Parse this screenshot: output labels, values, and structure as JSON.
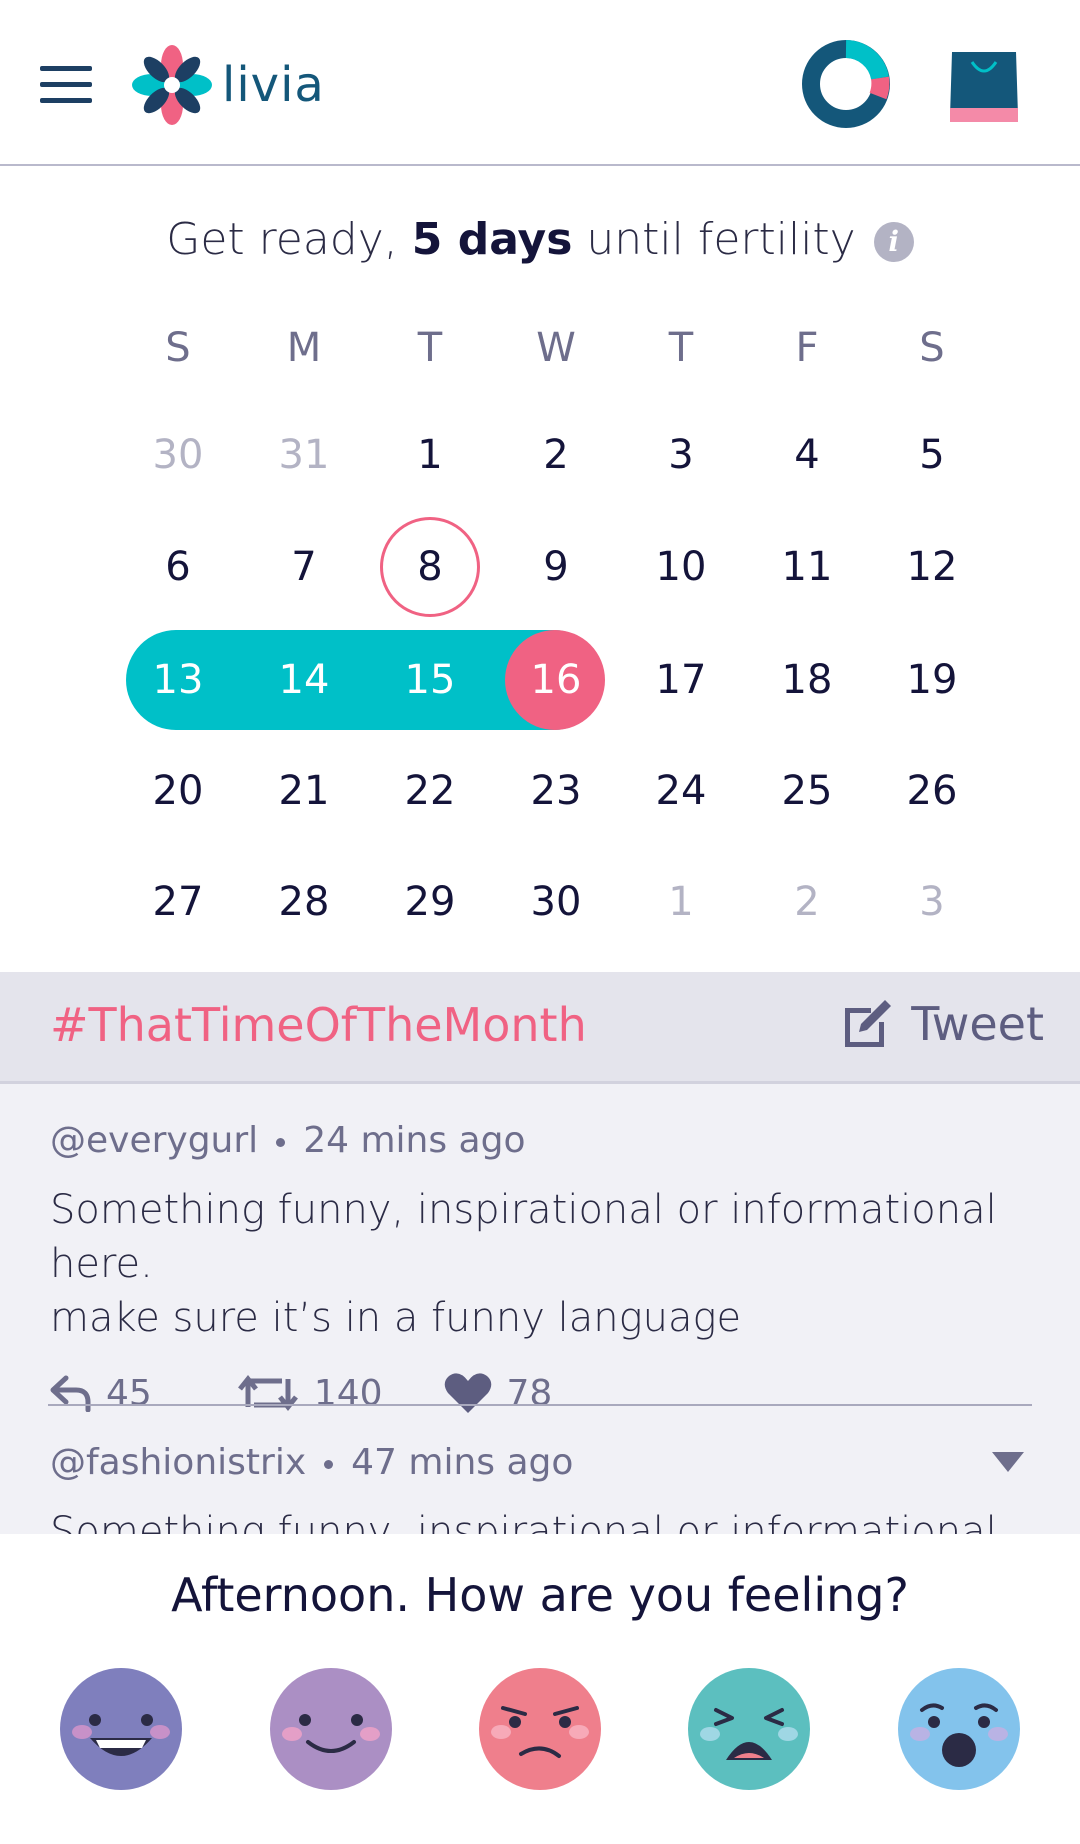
{
  "app": {
    "name": "livia"
  },
  "banner": {
    "prefix": "Get ready, ",
    "bold": "5 days",
    "suffix": " until fertility",
    "info": "i"
  },
  "calendar": {
    "weekdays": [
      "S",
      "M",
      "T",
      "W",
      "T",
      "F",
      "S"
    ],
    "weeks": [
      [
        "30",
        "31",
        "1",
        "2",
        "3",
        "4",
        "5"
      ],
      [
        "6",
        "7",
        "8",
        "9",
        "10",
        "11",
        "12"
      ],
      [
        "13",
        "14",
        "15",
        "16",
        "17",
        "18",
        "19"
      ],
      [
        "20",
        "21",
        "22",
        "23",
        "24",
        "25",
        "26"
      ],
      [
        "27",
        "28",
        "29",
        "30",
        "1",
        "2",
        "3"
      ]
    ],
    "today": "8",
    "period_days": [
      "13",
      "14",
      "15",
      "16"
    ],
    "period_end_day": "16",
    "colors": {
      "period": "#00c0c8",
      "highlight": "#f06283",
      "muted": "#b3b3c4"
    }
  },
  "twitter": {
    "hashtag": "#ThatTimeOfTheMonth",
    "tweet_label": "Tweet",
    "tweets": [
      {
        "handle": "@everygurl",
        "time": "24 mins ago",
        "text_line1": "Something funny, inspirational or informational here.",
        "text_line2": "make sure it’s in a funny language",
        "replies": "45",
        "retweets": "140",
        "likes": "78"
      },
      {
        "handle": "@fashionistrix",
        "time": "47 mins ago",
        "text_line1": "Something funny, inspirational or informational here."
      }
    ]
  },
  "mood": {
    "question": "Afternoon. How are you feeling?",
    "faces": [
      "happy-face-icon",
      "content-face-icon",
      "annoyed-face-icon",
      "distressed-face-icon",
      "surprised-face-icon"
    ]
  }
}
